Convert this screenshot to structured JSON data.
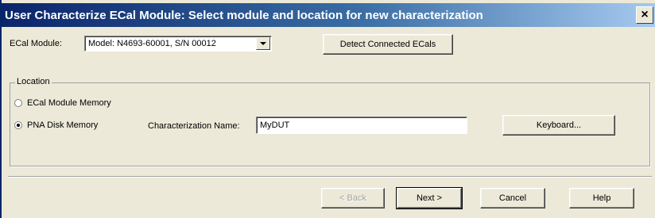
{
  "window": {
    "title": "User Characterize ECal Module: Select module and location for new characterization",
    "close_label": "×"
  },
  "ecal": {
    "label": "ECal Module:",
    "selected": "Model: N4693-60001, S/N 00012",
    "detect_label": "Detect Connected ECals"
  },
  "location": {
    "legend": "Location",
    "option_memory": "ECal Module Memory",
    "option_disk": "PNA Disk Memory",
    "selected": "PNA Disk Memory",
    "char_name_label": "Characterization Name:",
    "char_name_value": "MyDUT",
    "keyboard_label": "Keyboard..."
  },
  "footer": {
    "back_label": "< Back",
    "next_label": "Next >",
    "cancel_label": "Cancel",
    "help_label": "Help"
  },
  "colors": {
    "title_start": "#0a246a",
    "title_end": "#a6caf0",
    "face": "#ece9d8"
  }
}
